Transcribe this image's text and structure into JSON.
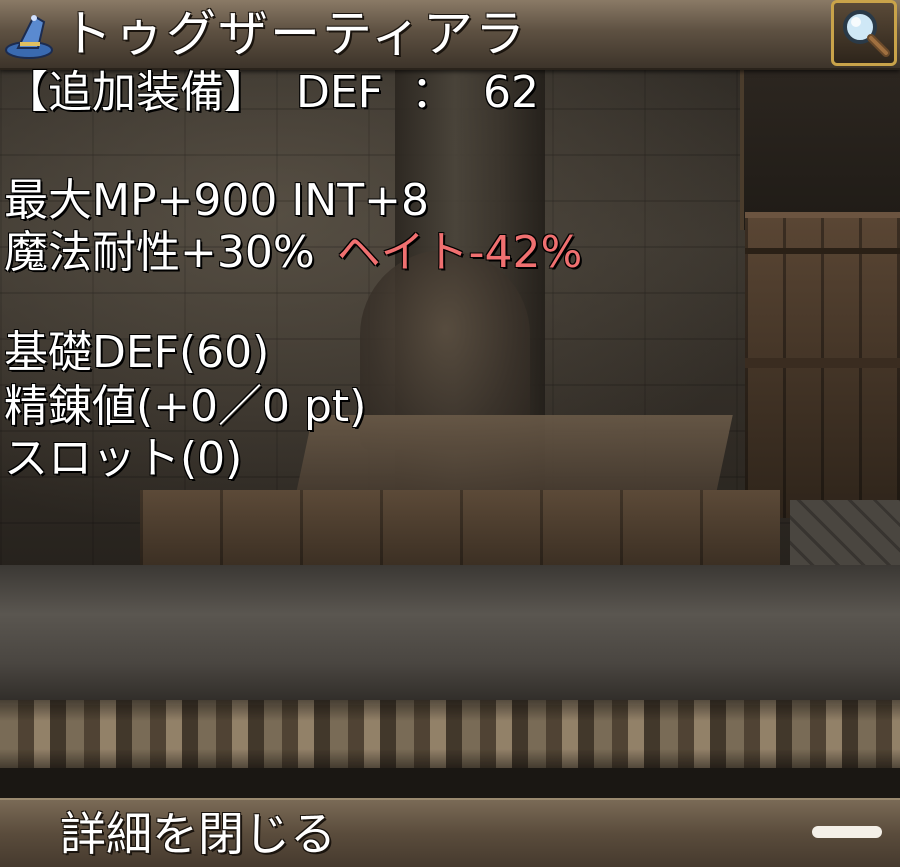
{
  "header": {
    "title": "トゥグザーティアラ",
    "icon": "wizard-hat-icon",
    "zoom_icon": "magnifier-icon"
  },
  "stats": {
    "extra_label": "【追加装備】",
    "def_label": "DEF",
    "def_separator": "：",
    "def_value": "62",
    "bonus_line1": "最大MP+900 INT+8",
    "resist_text": "魔法耐性+30%",
    "hate_text": "ヘイト-42%",
    "base_def": "基礎DEF(60)",
    "refine": "精錬値(+0／0 pt)",
    "slot": "スロット(0)"
  },
  "footer": {
    "close_label": "詳細を閉じる"
  },
  "colors": {
    "text": "#ffffff",
    "hate": "#f07070",
    "zoom_border": "#c9a34a"
  }
}
